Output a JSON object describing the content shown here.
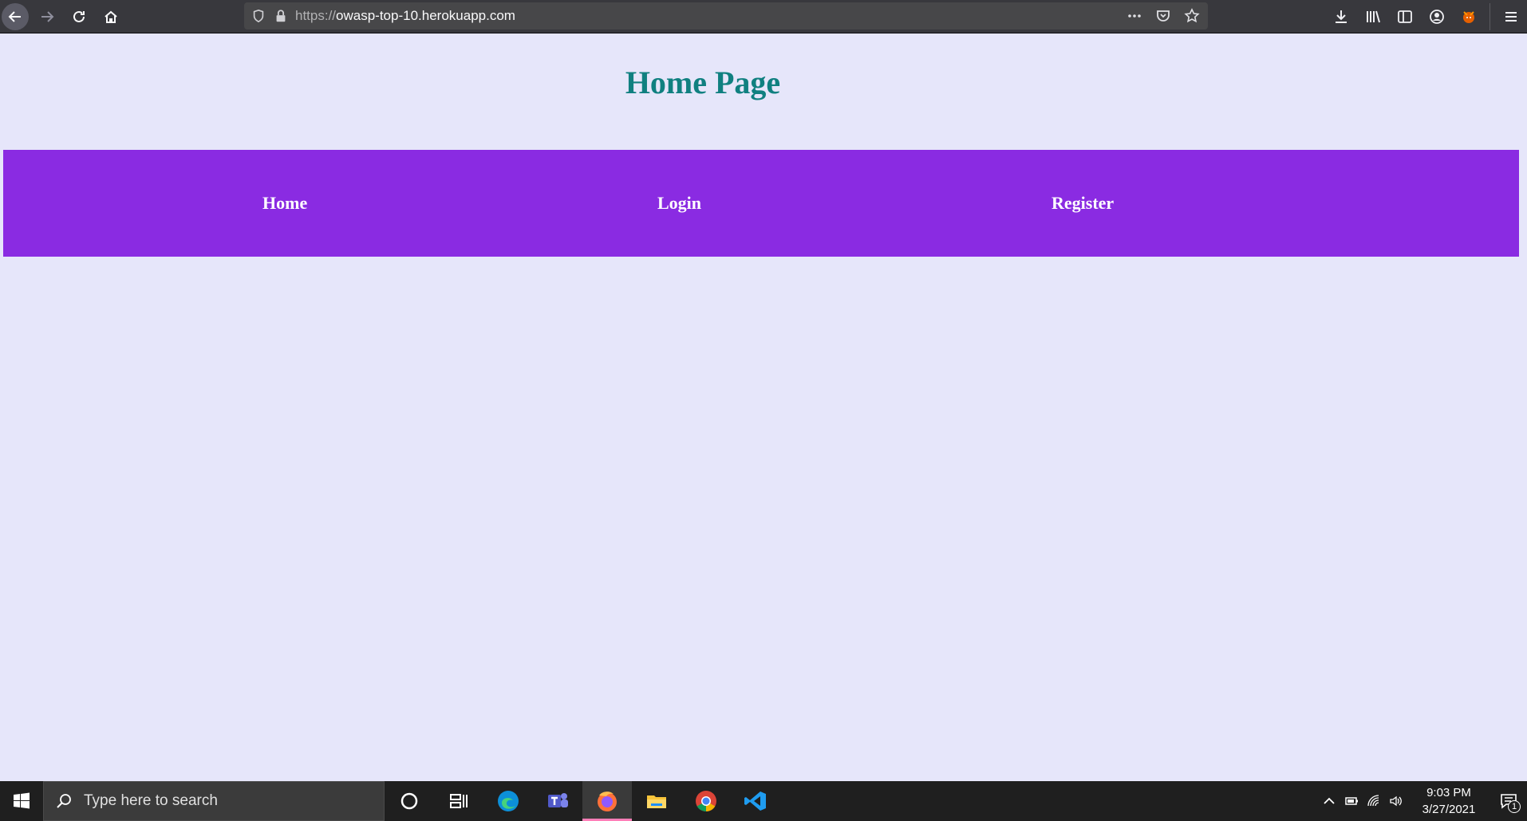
{
  "browser": {
    "url_scheme": "https://",
    "url_host": "owasp-top-10.herokuapp.com"
  },
  "page": {
    "title": "Home Page",
    "nav": [
      {
        "label": "Home"
      },
      {
        "label": "Login"
      },
      {
        "label": "Register"
      }
    ],
    "colors": {
      "background": "#e6e6fa",
      "title": "#108080",
      "navbar": "#8a2be2",
      "nav_text": "#ffffff"
    }
  },
  "taskbar": {
    "search_placeholder": "Type here to search",
    "apps": [
      "cortana-icon",
      "task-view-icon",
      "edge-icon",
      "teams-icon",
      "firefox-icon",
      "file-explorer-icon",
      "chrome-icon",
      "vscode-icon"
    ],
    "active_app": "firefox-icon",
    "time": "9:03 PM",
    "date": "3/27/2021",
    "notification_count": "1"
  }
}
